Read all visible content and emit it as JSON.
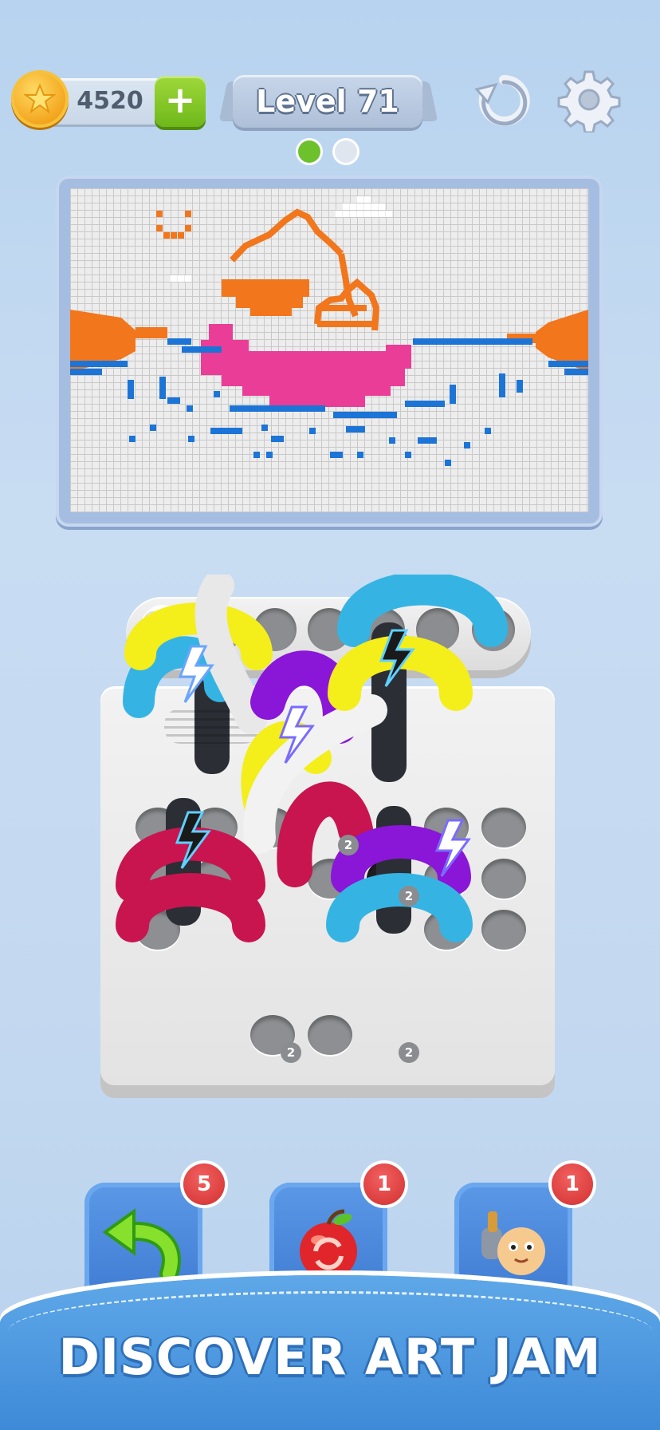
{
  "header": {
    "coins": "4520",
    "add_coins_label": "+",
    "level_label": "Level 71",
    "restart_icon": "restart-icon",
    "settings_icon": "gear-icon",
    "progress_dots": {
      "current": 1,
      "total": 2
    }
  },
  "colors": {
    "orange": "#f2761c",
    "pink": "#ea3d97",
    "blue": "#1c74d6",
    "yellow": "#f4ee1b",
    "cyan": "#35b4e4",
    "purple": "#8a16d8",
    "crimson": "#c8144f",
    "black": "#2b2e35",
    "white": "#f2f2f2"
  },
  "puzzle": {
    "stack_badges": [
      "2",
      "2",
      "2",
      "2"
    ]
  },
  "boosters": [
    {
      "name": "undo",
      "icon": "undo-arrow-icon",
      "count": "5"
    },
    {
      "name": "shuffle",
      "icon": "apple-shuffle-icon",
      "count": "1"
    },
    {
      "name": "helper",
      "icon": "worm-helper-icon",
      "count": "1"
    }
  ],
  "banner": {
    "text": "DISCOVER ART JAM"
  }
}
